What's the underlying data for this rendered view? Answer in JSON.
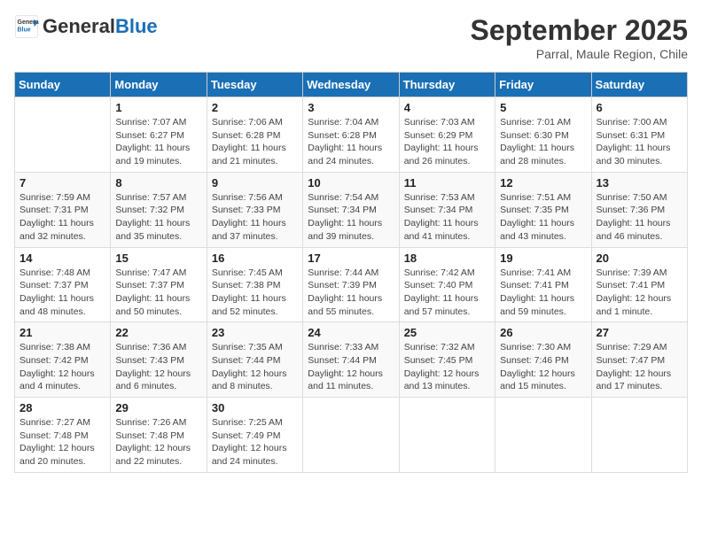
{
  "header": {
    "logo_general": "General",
    "logo_blue": "Blue",
    "month_title": "September 2025",
    "subtitle": "Parral, Maule Region, Chile"
  },
  "days_of_week": [
    "Sunday",
    "Monday",
    "Tuesday",
    "Wednesday",
    "Thursday",
    "Friday",
    "Saturday"
  ],
  "weeks": [
    [
      {
        "day": "",
        "info": ""
      },
      {
        "day": "1",
        "info": "Sunrise: 7:07 AM\nSunset: 6:27 PM\nDaylight: 11 hours\nand 19 minutes."
      },
      {
        "day": "2",
        "info": "Sunrise: 7:06 AM\nSunset: 6:28 PM\nDaylight: 11 hours\nand 21 minutes."
      },
      {
        "day": "3",
        "info": "Sunrise: 7:04 AM\nSunset: 6:28 PM\nDaylight: 11 hours\nand 24 minutes."
      },
      {
        "day": "4",
        "info": "Sunrise: 7:03 AM\nSunset: 6:29 PM\nDaylight: 11 hours\nand 26 minutes."
      },
      {
        "day": "5",
        "info": "Sunrise: 7:01 AM\nSunset: 6:30 PM\nDaylight: 11 hours\nand 28 minutes."
      },
      {
        "day": "6",
        "info": "Sunrise: 7:00 AM\nSunset: 6:31 PM\nDaylight: 11 hours\nand 30 minutes."
      }
    ],
    [
      {
        "day": "7",
        "info": "Sunrise: 7:59 AM\nSunset: 7:31 PM\nDaylight: 11 hours\nand 32 minutes."
      },
      {
        "day": "8",
        "info": "Sunrise: 7:57 AM\nSunset: 7:32 PM\nDaylight: 11 hours\nand 35 minutes."
      },
      {
        "day": "9",
        "info": "Sunrise: 7:56 AM\nSunset: 7:33 PM\nDaylight: 11 hours\nand 37 minutes."
      },
      {
        "day": "10",
        "info": "Sunrise: 7:54 AM\nSunset: 7:34 PM\nDaylight: 11 hours\nand 39 minutes."
      },
      {
        "day": "11",
        "info": "Sunrise: 7:53 AM\nSunset: 7:34 PM\nDaylight: 11 hours\nand 41 minutes."
      },
      {
        "day": "12",
        "info": "Sunrise: 7:51 AM\nSunset: 7:35 PM\nDaylight: 11 hours\nand 43 minutes."
      },
      {
        "day": "13",
        "info": "Sunrise: 7:50 AM\nSunset: 7:36 PM\nDaylight: 11 hours\nand 46 minutes."
      }
    ],
    [
      {
        "day": "14",
        "info": "Sunrise: 7:48 AM\nSunset: 7:37 PM\nDaylight: 11 hours\nand 48 minutes."
      },
      {
        "day": "15",
        "info": "Sunrise: 7:47 AM\nSunset: 7:37 PM\nDaylight: 11 hours\nand 50 minutes."
      },
      {
        "day": "16",
        "info": "Sunrise: 7:45 AM\nSunset: 7:38 PM\nDaylight: 11 hours\nand 52 minutes."
      },
      {
        "day": "17",
        "info": "Sunrise: 7:44 AM\nSunset: 7:39 PM\nDaylight: 11 hours\nand 55 minutes."
      },
      {
        "day": "18",
        "info": "Sunrise: 7:42 AM\nSunset: 7:40 PM\nDaylight: 11 hours\nand 57 minutes."
      },
      {
        "day": "19",
        "info": "Sunrise: 7:41 AM\nSunset: 7:41 PM\nDaylight: 11 hours\nand 59 minutes."
      },
      {
        "day": "20",
        "info": "Sunrise: 7:39 AM\nSunset: 7:41 PM\nDaylight: 12 hours\nand 1 minute."
      }
    ],
    [
      {
        "day": "21",
        "info": "Sunrise: 7:38 AM\nSunset: 7:42 PM\nDaylight: 12 hours\nand 4 minutes."
      },
      {
        "day": "22",
        "info": "Sunrise: 7:36 AM\nSunset: 7:43 PM\nDaylight: 12 hours\nand 6 minutes."
      },
      {
        "day": "23",
        "info": "Sunrise: 7:35 AM\nSunset: 7:44 PM\nDaylight: 12 hours\nand 8 minutes."
      },
      {
        "day": "24",
        "info": "Sunrise: 7:33 AM\nSunset: 7:44 PM\nDaylight: 12 hours\nand 11 minutes."
      },
      {
        "day": "25",
        "info": "Sunrise: 7:32 AM\nSunset: 7:45 PM\nDaylight: 12 hours\nand 13 minutes."
      },
      {
        "day": "26",
        "info": "Sunrise: 7:30 AM\nSunset: 7:46 PM\nDaylight: 12 hours\nand 15 minutes."
      },
      {
        "day": "27",
        "info": "Sunrise: 7:29 AM\nSunset: 7:47 PM\nDaylight: 12 hours\nand 17 minutes."
      }
    ],
    [
      {
        "day": "28",
        "info": "Sunrise: 7:27 AM\nSunset: 7:48 PM\nDaylight: 12 hours\nand 20 minutes."
      },
      {
        "day": "29",
        "info": "Sunrise: 7:26 AM\nSunset: 7:48 PM\nDaylight: 12 hours\nand 22 minutes."
      },
      {
        "day": "30",
        "info": "Sunrise: 7:25 AM\nSunset: 7:49 PM\nDaylight: 12 hours\nand 24 minutes."
      },
      {
        "day": "",
        "info": ""
      },
      {
        "day": "",
        "info": ""
      },
      {
        "day": "",
        "info": ""
      },
      {
        "day": "",
        "info": ""
      }
    ]
  ]
}
